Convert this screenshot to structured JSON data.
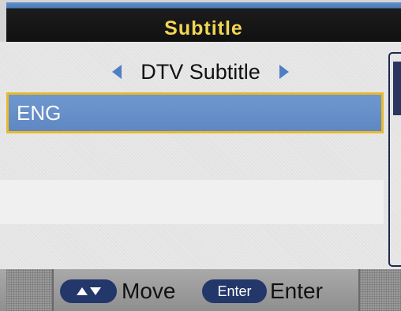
{
  "title": "Subtitle",
  "selector": {
    "label": "DTV Subtitle",
    "left_icon": "triangle-left-icon",
    "right_icon": "triangle-right-icon"
  },
  "list": {
    "items": [
      "ENG"
    ],
    "selected_index": 0
  },
  "footer": {
    "move_key_icon": "up-down-arrows-icon",
    "move_label": "Move",
    "enter_key_label": "Enter",
    "enter_label": "Enter"
  },
  "colors": {
    "title_text": "#f0d654",
    "selection_fill": "#6a92cb",
    "selection_border": "#e7b92c",
    "arrow": "#4d7fc2",
    "key_pill": "#23376a"
  }
}
